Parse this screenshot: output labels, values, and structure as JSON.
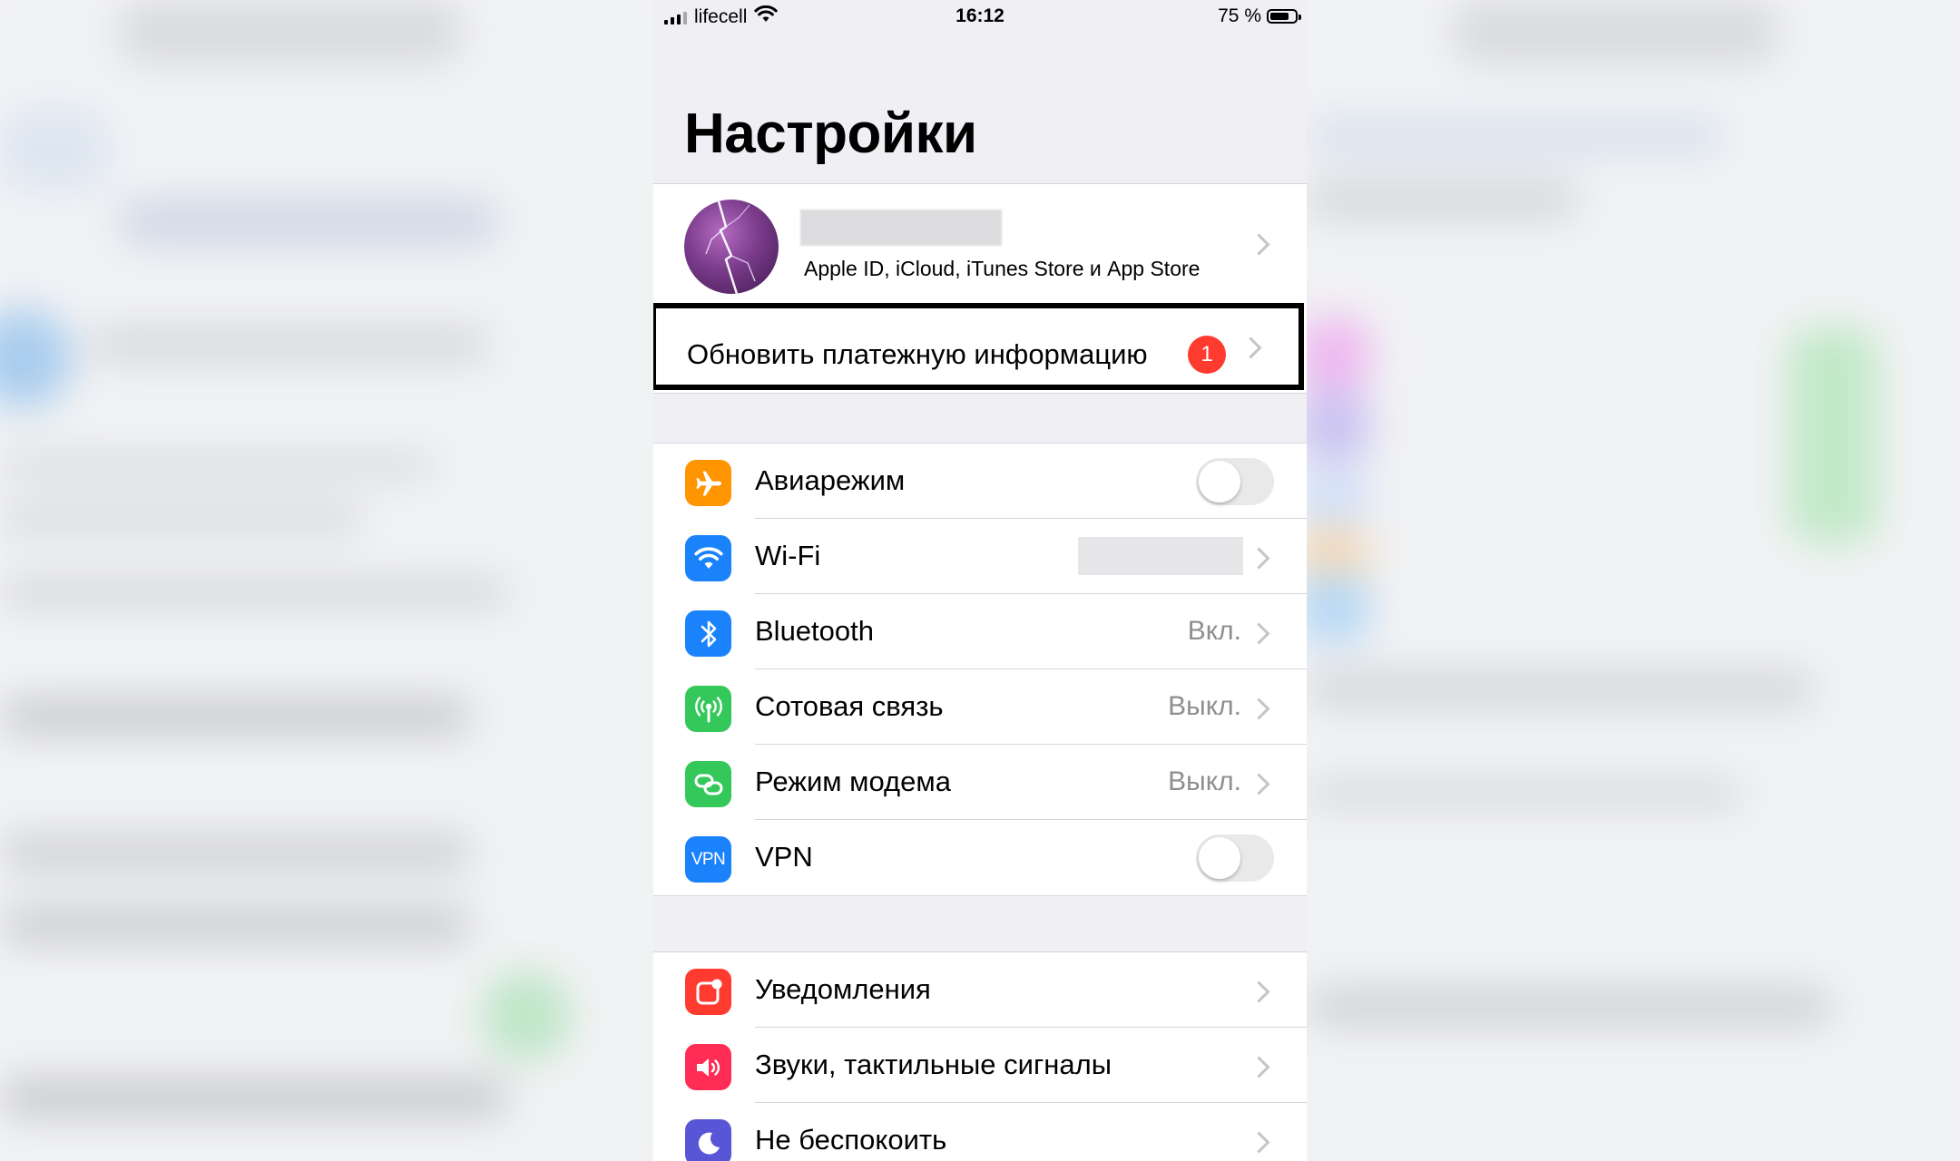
{
  "status_bar": {
    "carrier": "lifecell",
    "time": "16:12",
    "battery": "75 %",
    "battery_level": 0.75
  },
  "title": "Настройки",
  "profile": {
    "subtitle": "Apple ID, iCloud, iTunes Store и App Store"
  },
  "payment": {
    "label": "Обновить платежную информацию",
    "badge": "1"
  },
  "connectivity": [
    {
      "label": "Авиарежим",
      "icon": "airplane-icon",
      "color": "#ff9500",
      "toggle": false
    },
    {
      "label": "Wi-Fi",
      "icon": "wifi-icon",
      "color": "#1a82fb"
    },
    {
      "label": "Bluetooth",
      "icon": "bluetooth-icon",
      "color": "#1a82fb",
      "value": "Вкл."
    },
    {
      "label": "Сотовая связь",
      "icon": "cellular-antenna-icon",
      "color": "#34c759",
      "value": "Выкл."
    },
    {
      "label": "Режим модема",
      "icon": "hotspot-icon",
      "color": "#34c759",
      "value": "Выкл."
    },
    {
      "label": "VPN",
      "icon": "vpn-icon",
      "icon_text": "VPN",
      "color": "#1a82fb",
      "toggle": false
    }
  ],
  "general": [
    {
      "label": "Уведомления",
      "icon": "notifications-icon",
      "color": "#ff3b30"
    },
    {
      "label": "Звуки, тактильные сигналы",
      "icon": "sounds-icon",
      "color": "#ff2d55"
    },
    {
      "label": "Не беспокоить",
      "icon": "moon-icon",
      "color": "#5856d6"
    }
  ]
}
